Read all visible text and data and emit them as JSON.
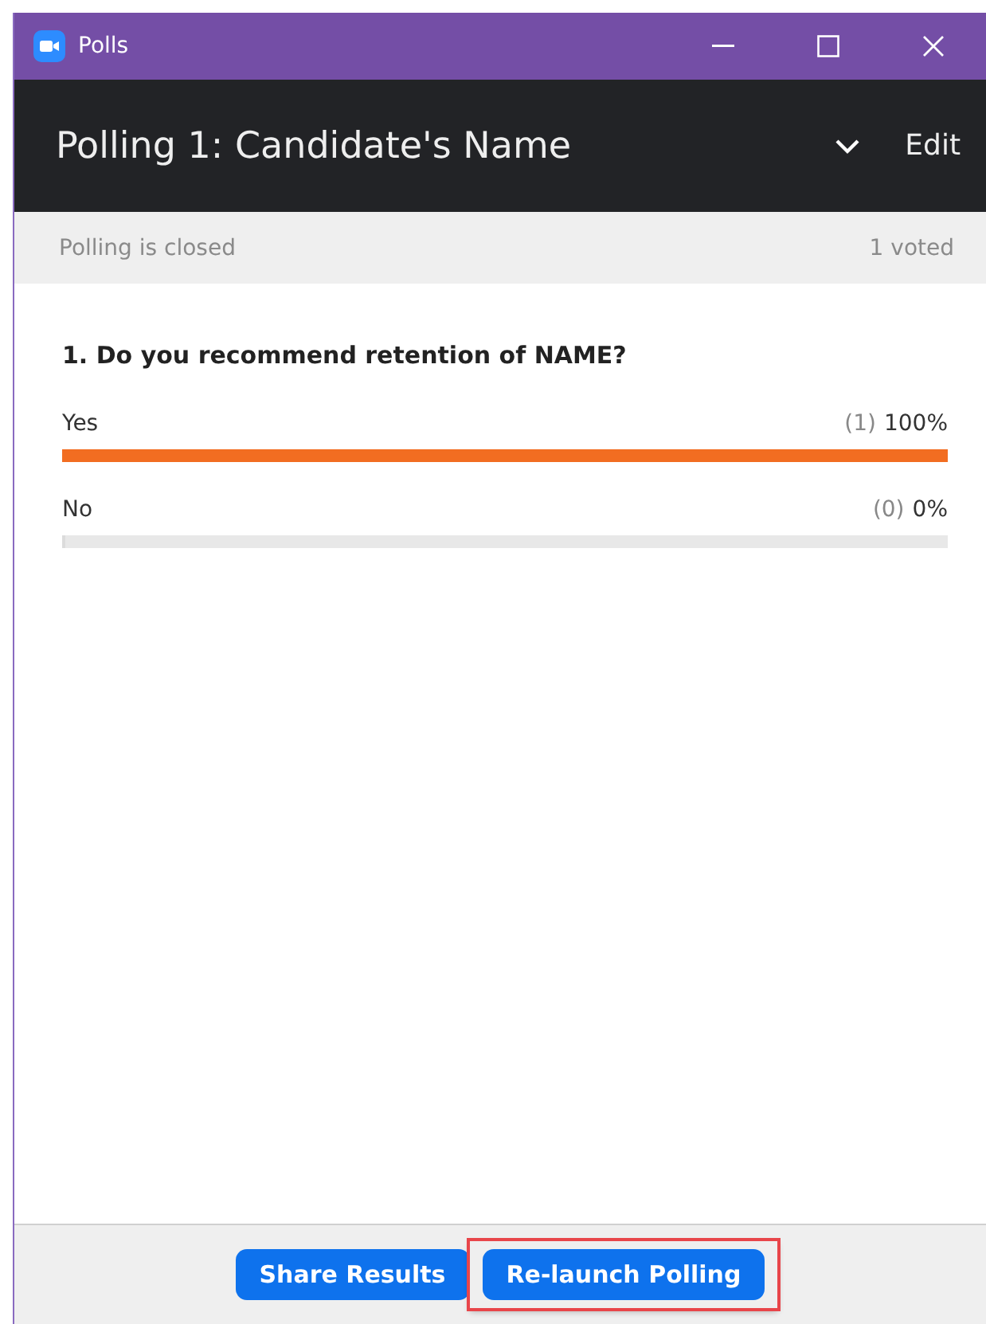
{
  "window": {
    "title": "Polls"
  },
  "header": {
    "title": "Polling 1: Candidate's Name",
    "edit": "Edit"
  },
  "status_bar": {
    "state": "Polling is closed",
    "votes": "1 voted"
  },
  "question": {
    "text": "1. Do you recommend retention of NAME?",
    "answers": [
      {
        "label": "Yes",
        "count": "(1)",
        "percent": "100%",
        "level": 1
      },
      {
        "label": "No",
        "count": "(0)",
        "percent": "0%",
        "level": 0
      }
    ]
  },
  "buttons": [
    {
      "label": "Share Results",
      "highlighted": false
    },
    {
      "label": "Re-launch Polling",
      "highlighted": true
    }
  ]
}
